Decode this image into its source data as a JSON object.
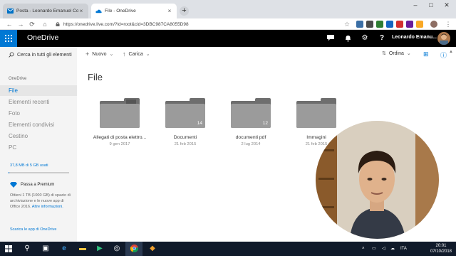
{
  "browser": {
    "tabs": [
      {
        "title": "Posta - Leonardo Emanuel Cortes"
      },
      {
        "title": "File - OneDrive"
      }
    ],
    "new_tab_label": "+",
    "url": "https://onedrive.live.com/?id=root&cid=3DBC987CA8055D98",
    "window_controls": {
      "minimize": "–",
      "maximize": "□",
      "close": "✕"
    }
  },
  "header": {
    "app_name": "OneDrive",
    "user_name": "Leonardo Emanu..."
  },
  "sidebar": {
    "search_placeholder": "Cerca in tutti gli elementi",
    "section_label": "OneDrive",
    "items": [
      {
        "label": "File",
        "active": true
      },
      {
        "label": "Elementi recenti",
        "active": false
      },
      {
        "label": "Foto",
        "active": false
      },
      {
        "label": "Elementi condivisi",
        "active": false
      },
      {
        "label": "Cestino",
        "active": false
      },
      {
        "label": "PC",
        "active": false
      }
    ],
    "storage_text": "37,8 MB di 5 GB usati",
    "storage_fraction": 0.0076,
    "premium": {
      "title": "Passa a Premium",
      "text": "Ottieni 1 TB (1000 GB) di spazio di archiviazione e le nuove app di Office 2016.",
      "link": "Altre informazioni."
    },
    "get_apps": "Scarica le app di OneDrive"
  },
  "commands": {
    "new": "Nuovo",
    "upload": "Carica",
    "sort": "Ordina"
  },
  "main": {
    "title": "File",
    "folders": [
      {
        "name": "Allegati di posta elettro...",
        "date": "9 gen 2017",
        "count": "",
        "shared": true
      },
      {
        "name": "Documenti",
        "date": "21 feb 2015",
        "count": "14",
        "shared": false
      },
      {
        "name": "documenti pdf",
        "date": "2 lug 2014",
        "count": "12",
        "shared": false
      },
      {
        "name": "Immagini",
        "date": "21 feb 2015",
        "count": "",
        "shared": false
      }
    ]
  },
  "taskbar": {
    "language": "ITA",
    "time": "20:01",
    "date": "07/10/2018"
  },
  "colors": {
    "accent": "#0078d4",
    "header_bg": "#000000",
    "sidebar_bg": "#f4f4f4",
    "folder": "#9b9b9b",
    "taskbar": "#101a2a"
  }
}
